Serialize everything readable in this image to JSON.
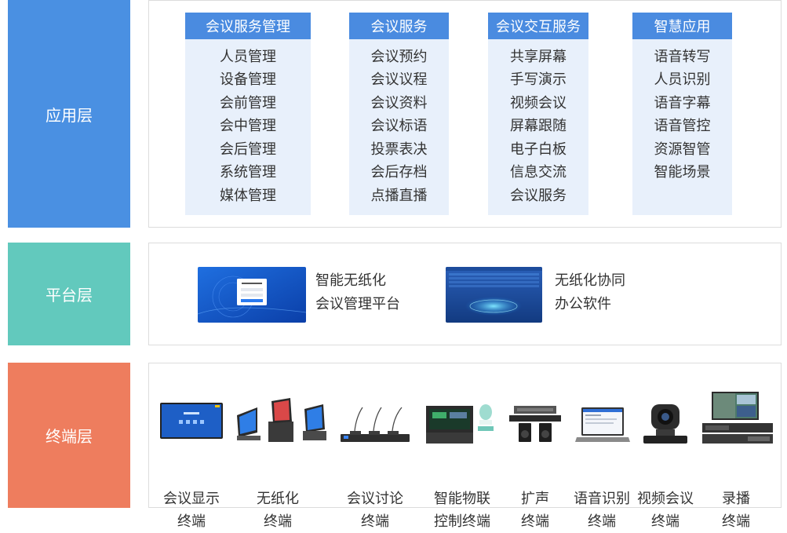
{
  "layers": {
    "app": {
      "label": "应用层",
      "color": "#4a90e2"
    },
    "platform": {
      "label": "平台层",
      "color": "#62c9bd"
    },
    "terminal": {
      "label": "终端层",
      "color": "#ee7d5e"
    }
  },
  "app_columns": [
    {
      "title": "会议服务管理",
      "items": [
        "人员管理",
        "设备管理",
        "会前管理",
        "会中管理",
        "会后管理",
        "系统管理",
        "媒体管理"
      ]
    },
    {
      "title": "会议服务",
      "items": [
        "会议预约",
        "会议议程",
        "会议资料",
        "会议标语",
        "投票表决",
        "会后存档",
        "点播直播"
      ]
    },
    {
      "title": "会议交互服务",
      "items": [
        "共享屏幕",
        "手写演示",
        "视频会议",
        "屏幕跟随",
        "电子白板",
        "信息交流",
        "会议服务"
      ]
    },
    {
      "title": "智慧应用",
      "items": [
        "语音转写",
        "人员识别",
        "语音字幕",
        "语音管控",
        "资源智管",
        "智能场景"
      ]
    }
  ],
  "platform_items": [
    {
      "line1": "智能无纸化",
      "line2": "会议管理平台",
      "icon": "login-screen-thumbnail"
    },
    {
      "line1": "无纸化协同",
      "line2": "办公软件",
      "icon": "dashboard-screen-thumbnail"
    }
  ],
  "terminals": [
    {
      "line1": "会议显示",
      "line2": "终端",
      "icon": "display-screen-icon"
    },
    {
      "line1": "无纸化",
      "line2": "终端",
      "icon": "lift-monitor-icon"
    },
    {
      "line1": "会议讨论",
      "line2": "终端",
      "icon": "microphone-unit-icon"
    },
    {
      "line1": "智能物联",
      "line2": "控制终端",
      "icon": "control-host-icon"
    },
    {
      "line1": "扩声",
      "line2": "终端",
      "icon": "speaker-amp-icon"
    },
    {
      "line1": "语音识别",
      "line2": "终端",
      "icon": "laptop-icon"
    },
    {
      "line1": "视频会议",
      "line2": "终端",
      "icon": "ptz-camera-icon"
    },
    {
      "line1": "录播",
      "line2": "终端",
      "icon": "recording-host-icon"
    }
  ]
}
